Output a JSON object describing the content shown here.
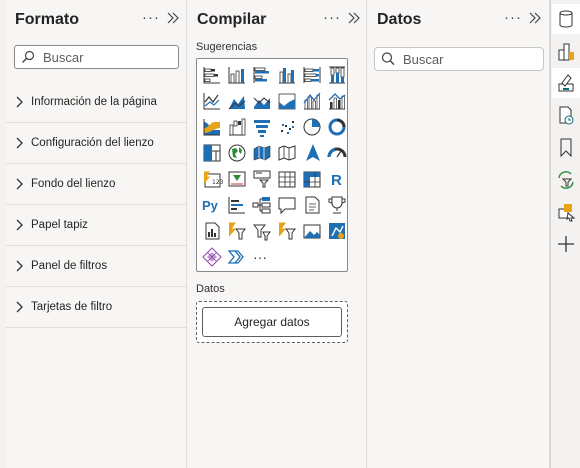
{
  "format_pane": {
    "title": "Formato",
    "more_label": "···",
    "search_placeholder": "Buscar",
    "sections": [
      {
        "label": "Información de la página"
      },
      {
        "label": "Configuración del lienzo"
      },
      {
        "label": "Fondo del lienzo"
      },
      {
        "label": "Papel tapiz"
      },
      {
        "label": "Panel de filtros"
      },
      {
        "label": "Tarjetas de filtro"
      }
    ]
  },
  "build_pane": {
    "title": "Compilar",
    "more_label": "···",
    "suggestions_label": "Sugerencias",
    "visuals": [
      {
        "name": "stacked-bar-chart-icon"
      },
      {
        "name": "stacked-column-chart-icon"
      },
      {
        "name": "clustered-bar-chart-icon"
      },
      {
        "name": "clustered-column-chart-icon"
      },
      {
        "name": "100-stacked-bar-chart-icon"
      },
      {
        "name": "100-stacked-column-chart-icon"
      },
      {
        "name": "line-chart-icon"
      },
      {
        "name": "area-chart-icon"
      },
      {
        "name": "stacked-area-chart-icon"
      },
      {
        "name": "100-stacked-area-chart-icon"
      },
      {
        "name": "line-and-stacked-column-chart-icon"
      },
      {
        "name": "line-and-clustered-column-chart-icon"
      },
      {
        "name": "ribbon-chart-icon"
      },
      {
        "name": "waterfall-chart-icon"
      },
      {
        "name": "funnel-icon"
      },
      {
        "name": "scatter-chart-icon"
      },
      {
        "name": "pie-chart-icon"
      },
      {
        "name": "donut-chart-icon"
      },
      {
        "name": "treemap-icon"
      },
      {
        "name": "map-icon"
      },
      {
        "name": "filled-map-icon"
      },
      {
        "name": "shape-map-icon"
      },
      {
        "name": "azure-map-icon"
      },
      {
        "name": "gauge-icon"
      },
      {
        "name": "card-icon"
      },
      {
        "name": "kpi-icon"
      },
      {
        "name": "slicer-icon"
      },
      {
        "name": "table-icon"
      },
      {
        "name": "matrix-icon"
      },
      {
        "name": "r-visual-icon"
      },
      {
        "name": "python-visual-icon"
      },
      {
        "name": "key-influencers-icon"
      },
      {
        "name": "decomposition-tree-icon"
      },
      {
        "name": "qa-icon"
      },
      {
        "name": "smart-narrative-icon"
      },
      {
        "name": "metrics-icon"
      },
      {
        "name": "paginated-report-icon"
      },
      {
        "name": "power-automate-icon"
      },
      {
        "name": "power-apps-icon"
      },
      {
        "name": "power-automate-flow-icon"
      },
      {
        "name": "image-icon"
      },
      {
        "name": "arcgis-map-icon"
      },
      {
        "name": "power-apps-diamond-icon"
      },
      {
        "name": "chevron-visual-icon"
      },
      {
        "name": "more-visuals-icon"
      }
    ],
    "more_visuals_label": "···",
    "data_label": "Datos",
    "add_data_label": "Agregar datos"
  },
  "data_pane": {
    "title": "Datos",
    "more_label": "···",
    "search_placeholder": "Buscar"
  },
  "colors": {
    "accent_blue": "#1f6fb5",
    "accent_yellow": "#e8a317",
    "accent_teal": "#0b6a7a",
    "pane_bg": "#f7f6f5",
    "border": "#e1dfdd"
  },
  "rail": [
    {
      "name": "data-cylinder-icon"
    },
    {
      "name": "build-visual-icon"
    },
    {
      "name": "format-paintbrush-icon"
    },
    {
      "name": "performance-analyzer-icon"
    },
    {
      "name": "bookmark-icon"
    },
    {
      "name": "sync-slicers-icon"
    },
    {
      "name": "selection-icon"
    },
    {
      "name": "add-pane-icon"
    }
  ]
}
